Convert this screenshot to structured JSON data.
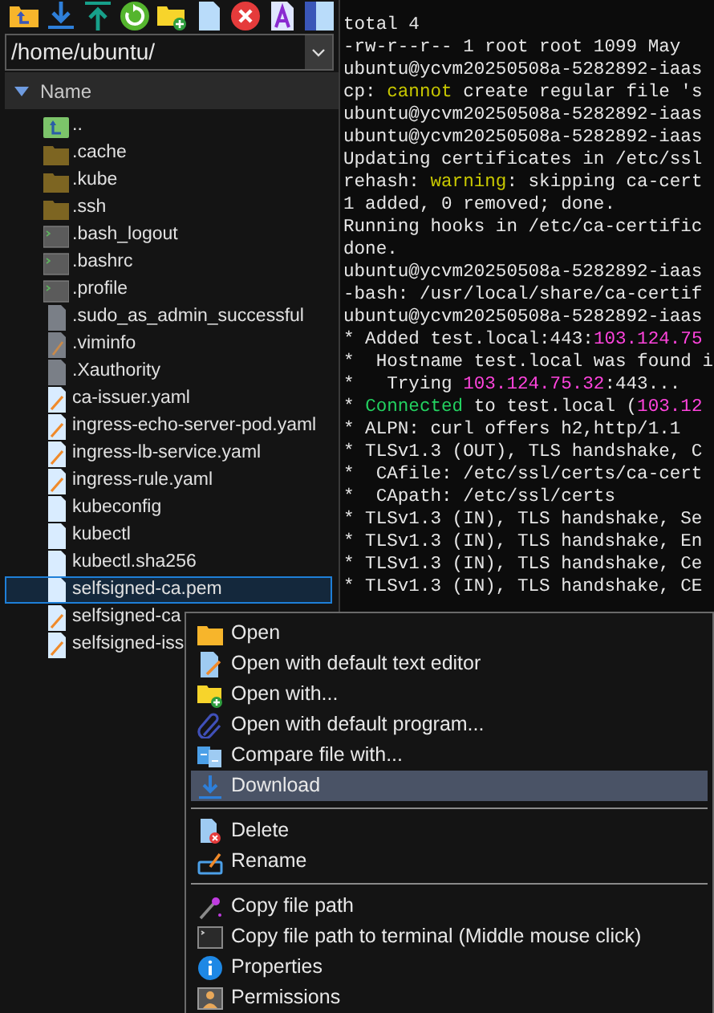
{
  "path_field": {
    "value": "/home/ubuntu/"
  },
  "column_header": {
    "label": "Name"
  },
  "files": [
    {
      "name": "..",
      "kind": "up",
      "selected": false
    },
    {
      "name": ".cache",
      "kind": "folder",
      "selected": false
    },
    {
      "name": ".kube",
      "kind": "folder",
      "selected": false
    },
    {
      "name": ".ssh",
      "kind": "folder",
      "selected": false
    },
    {
      "name": ".bash_logout",
      "kind": "script",
      "selected": false
    },
    {
      "name": ".bashrc",
      "kind": "script",
      "selected": false
    },
    {
      "name": ".profile",
      "kind": "script",
      "selected": false
    },
    {
      "name": ".sudo_as_admin_successful",
      "kind": "blank",
      "selected": false
    },
    {
      "name": ".viminfo",
      "kind": "blank-edit",
      "selected": false
    },
    {
      "name": ".Xauthority",
      "kind": "blank",
      "selected": false
    },
    {
      "name": "ca-issuer.yaml",
      "kind": "edit",
      "selected": false
    },
    {
      "name": "ingress-echo-server-pod.yaml",
      "kind": "edit",
      "selected": false
    },
    {
      "name": "ingress-lb-service.yaml",
      "kind": "edit",
      "selected": false
    },
    {
      "name": "ingress-rule.yaml",
      "kind": "edit",
      "selected": false
    },
    {
      "name": "kubeconfig",
      "kind": "doc",
      "selected": false
    },
    {
      "name": "kubectl",
      "kind": "doc",
      "selected": false
    },
    {
      "name": "kubectl.sha256",
      "kind": "doc",
      "selected": false
    },
    {
      "name": "selfsigned-ca.pem",
      "kind": "doc",
      "selected": true
    },
    {
      "name": "selfsigned-ca",
      "kind": "edit",
      "selected": false
    },
    {
      "name": "selfsigned-iss",
      "kind": "edit",
      "selected": false
    }
  ],
  "terminal_lines": [
    [
      {
        "text": "total 4",
        "kind": "plain"
      }
    ],
    [
      {
        "text": "-rw-r--r-- 1 root root 1099 May",
        "kind": "plain"
      }
    ],
    [
      {
        "text": "ubuntu@ycvm20250508a-5282892-iaas",
        "kind": "plain"
      }
    ],
    [
      {
        "text": "cp: ",
        "kind": "plain"
      },
      {
        "text": "cannot",
        "kind": "warning"
      },
      {
        "text": " create regular file 's",
        "kind": "plain"
      }
    ],
    [
      {
        "text": "ubuntu@ycvm20250508a-5282892-iaas",
        "kind": "plain"
      }
    ],
    [
      {
        "text": "ubuntu@ycvm20250508a-5282892-iaas",
        "kind": "plain"
      }
    ],
    [
      {
        "text": "Updating certificates in /etc/ssl",
        "kind": "plain"
      }
    ],
    [
      {
        "text": "rehash: ",
        "kind": "plain"
      },
      {
        "text": "warning",
        "kind": "warning"
      },
      {
        "text": ": skipping ca-cert",
        "kind": "plain"
      }
    ],
    [
      {
        "text": "1 added, 0 removed; done.",
        "kind": "plain"
      }
    ],
    [
      {
        "text": "Running hooks in /etc/ca-certific",
        "kind": "plain"
      }
    ],
    [
      {
        "text": "done.",
        "kind": "plain"
      }
    ],
    [
      {
        "text": "ubuntu@ycvm20250508a-5282892-iaas",
        "kind": "plain"
      }
    ],
    [
      {
        "text": "-bash: /usr/local/share/ca-certif",
        "kind": "plain"
      }
    ],
    [
      {
        "text": "ubuntu@ycvm20250508a-5282892-iaas",
        "kind": "plain"
      }
    ],
    [
      {
        "text": "* Added test.local:443:",
        "kind": "plain"
      },
      {
        "text": "103.124.75",
        "kind": "address"
      }
    ],
    [
      {
        "text": "*  Hostname test.local was found i",
        "kind": "plain"
      }
    ],
    [
      {
        "text": "*   Trying ",
        "kind": "plain"
      },
      {
        "text": "103.124.75.32",
        "kind": "address"
      },
      {
        "text": ":443...",
        "kind": "plain"
      }
    ],
    [
      {
        "text": "* ",
        "kind": "plain"
      },
      {
        "text": "Connected",
        "kind": "success"
      },
      {
        "text": " to test.local (",
        "kind": "plain"
      },
      {
        "text": "103.12",
        "kind": "address"
      }
    ],
    [
      {
        "text": "* ALPN: curl offers h2,http/1.1",
        "kind": "plain"
      }
    ],
    [
      {
        "text": "* TLSv1.3 (OUT), TLS handshake, C",
        "kind": "plain"
      }
    ],
    [
      {
        "text": "*  CAfile: /etc/ssl/certs/ca-cert",
        "kind": "plain"
      }
    ],
    [
      {
        "text": "*  CApath: /etc/ssl/certs",
        "kind": "plain"
      }
    ],
    [
      {
        "text": "* TLSv1.3 (IN), TLS handshake, Se",
        "kind": "plain"
      }
    ],
    [
      {
        "text": "* TLSv1.3 (IN), TLS handshake, En",
        "kind": "plain"
      }
    ],
    [
      {
        "text": "* TLSv1.3 (IN), TLS handshake, Ce",
        "kind": "plain"
      }
    ],
    [
      {
        "text": "* TLSv1.3 (IN), TLS handshake, CE",
        "kind": "plain"
      }
    ]
  ],
  "context_menu": [
    [
      {
        "label": "Open",
        "kind": "folder",
        "selected": false
      },
      {
        "label": "Open with default text editor",
        "kind": "edit",
        "selected": false
      },
      {
        "label": "Open with...",
        "kind": "folder-plus",
        "selected": false
      },
      {
        "label": "Open with default program...",
        "kind": "clip",
        "selected": false
      },
      {
        "label": "Compare file with...",
        "kind": "compare",
        "selected": false
      },
      {
        "label": "Download",
        "kind": "download",
        "selected": true
      }
    ],
    [
      {
        "label": "Delete",
        "kind": "delete",
        "selected": false
      },
      {
        "label": "Rename",
        "kind": "rename",
        "selected": false
      }
    ],
    [
      {
        "label": "Copy file path",
        "kind": "wand",
        "selected": false
      },
      {
        "label": "Copy file path to terminal (Middle mouse click)",
        "kind": "terminal",
        "selected": false
      },
      {
        "label": "Properties",
        "kind": "info",
        "selected": false
      },
      {
        "label": "Permissions",
        "kind": "person",
        "selected": false
      }
    ]
  ]
}
